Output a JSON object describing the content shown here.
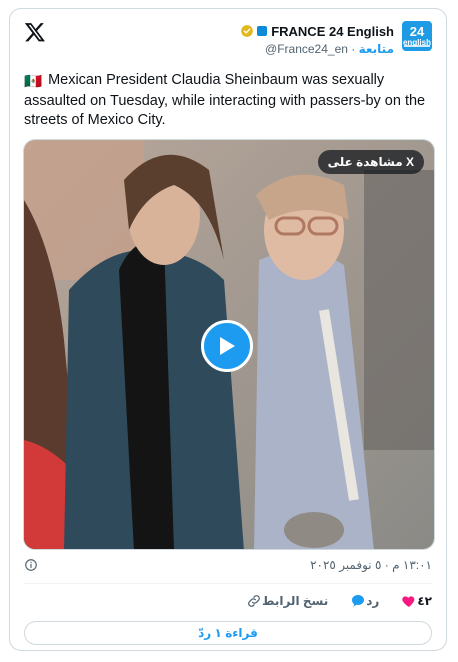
{
  "account": {
    "name": "FRANCE 24 English",
    "handle": "@France24_en",
    "separator": "·",
    "follow_label": "متابعة",
    "avatar_number": "24",
    "avatar_label": "english"
  },
  "tweet": {
    "flag": "🇲🇽",
    "text": "Mexican President Claudia Sheinbaum was sexually assaulted on Tuesday, while interacting with passers-by on the streets of Mexico City."
  },
  "media": {
    "watch_label": "مشاهدة على X",
    "play_icon": "play-icon"
  },
  "meta": {
    "timestamp": "١٣:٠١ م · ٥ نوفمبر ٢٠٢٥"
  },
  "actions": {
    "like_count": "٤٢",
    "reply_label": "رد",
    "copy_link_label": "نسخ الرابط"
  },
  "read_replies_label": "قراءة ١ ردّ",
  "colors": {
    "accent": "#1d9bf0",
    "like": "#f91880",
    "text": "#0f1419",
    "muted": "#536471",
    "border": "#cfd9de"
  }
}
